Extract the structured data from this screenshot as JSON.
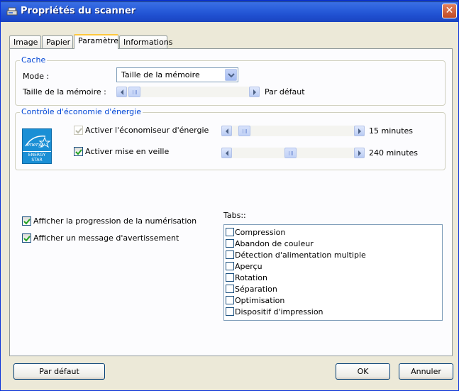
{
  "window": {
    "title": "Propriétés du scanner"
  },
  "tabs": [
    {
      "label": "Image"
    },
    {
      "label": "Papier"
    },
    {
      "label": "Paramètre"
    },
    {
      "label": "Informations"
    }
  ],
  "cache": {
    "group_label": "Cache",
    "mode_label": "Mode :",
    "mode_value": "Taille de la mémoire",
    "memory_label": "Taille de la mémoire :",
    "memory_value": "Par défaut"
  },
  "energy": {
    "group_label": "Contrôle d'économie d'énergie",
    "logo_text": "ENERGY STAR",
    "saver_label": "Activer l'économiseur d'énergie",
    "saver_checked": true,
    "saver_disabled": true,
    "saver_value": "15 minutes",
    "sleep_label": "Activer mise en veille",
    "sleep_checked": true,
    "sleep_value": "240 minutes"
  },
  "options": {
    "progress_label": "Afficher la progression de la numérisation",
    "progress_checked": true,
    "warning_label": "Afficher un message d'avertissement",
    "warning_checked": true
  },
  "tabs_list": {
    "label": "Tabs::",
    "items": [
      {
        "label": "Compression",
        "checked": false
      },
      {
        "label": "Abandon de couleur",
        "checked": false
      },
      {
        "label": "Détection d'alimentation multiple",
        "checked": false
      },
      {
        "label": "Aperçu",
        "checked": false
      },
      {
        "label": "Rotation",
        "checked": false
      },
      {
        "label": "Séparation",
        "checked": false
      },
      {
        "label": "Optimisation",
        "checked": false
      },
      {
        "label": "Dispositif d'impression",
        "checked": false
      }
    ]
  },
  "buttons": {
    "default_label": "Par défaut",
    "ok_label": "OK",
    "cancel_label": "Annuler"
  },
  "icons": {
    "app": "scanner-icon",
    "close": "close-icon",
    "dropdown": "chevron-down-icon",
    "scroll_left": "arrow-left-icon",
    "scroll_right": "arrow-right-icon",
    "checkmark": "checkmark-icon",
    "energy": "energy-star-logo"
  },
  "colors": {
    "titlebar": "#2a5fdc",
    "group_label": "#0046d5",
    "dialog_bg": "#ece9d8"
  }
}
